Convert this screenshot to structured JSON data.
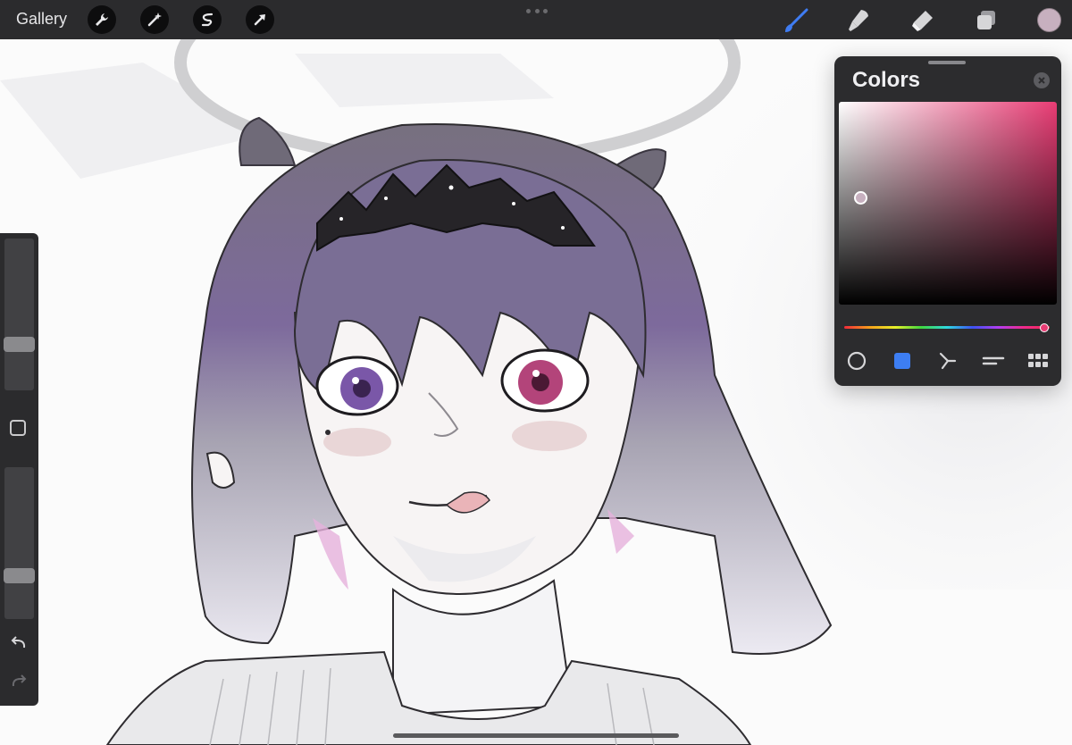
{
  "topbar": {
    "gallery_label": "Gallery",
    "left_tools": [
      {
        "icon": "wrench-icon"
      },
      {
        "icon": "magic-wand-icon"
      },
      {
        "icon": "selection-icon"
      },
      {
        "icon": "transform-arrow-icon"
      }
    ],
    "right_tools": [
      {
        "icon": "brush-icon",
        "active": true
      },
      {
        "icon": "smudge-icon",
        "active": false
      },
      {
        "icon": "eraser-icon",
        "active": false
      },
      {
        "icon": "layers-icon",
        "active": false
      }
    ],
    "current_color": "#c7b0bf"
  },
  "sidebar": {
    "brush_size_level": 0.28,
    "opacity_level": 0.26,
    "undo_icon": "undo-icon",
    "redo_icon": "redo-icon"
  },
  "colors_panel": {
    "title": "Colors",
    "hue_color": "#e83c74",
    "tabs": [
      {
        "icon": "disc-icon",
        "active": false
      },
      {
        "icon": "classic-square-icon",
        "active": true
      },
      {
        "icon": "harmony-icon",
        "active": false
      },
      {
        "icon": "value-sliders-icon",
        "active": false
      },
      {
        "icon": "palettes-grid-icon",
        "active": false
      }
    ]
  },
  "accent_colors": {
    "brush_active": "#3f7cf2",
    "tab_active": "#3d7ef3"
  }
}
